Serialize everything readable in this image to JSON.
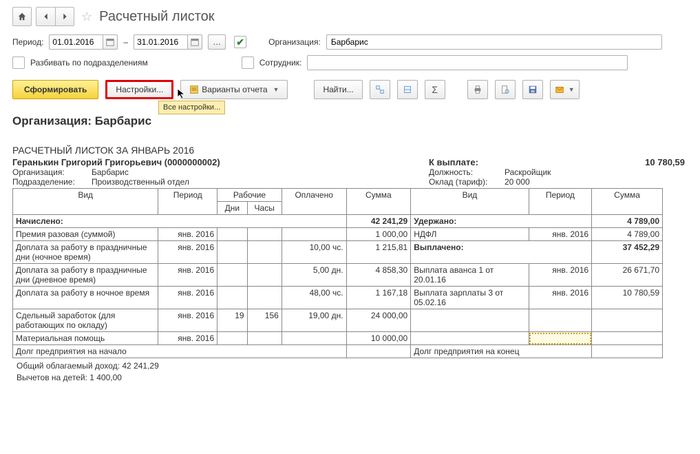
{
  "title": "Расчетный листок",
  "period_label": "Период:",
  "date_from": "01.01.2016",
  "date_sep": "–",
  "date_to": "31.01.2016",
  "org_label": "Организация:",
  "org_value": "Барбарис",
  "split_label": "Разбивать по подразделениям",
  "emp_label": "Сотрудник:",
  "btn_form": "Сформировать",
  "btn_settings": "Настройки...",
  "btn_variants": "Варианты отчета",
  "btn_find": "Найти...",
  "tooltip": "Все настройки...",
  "report": {
    "heading": "Организация: Барбарис",
    "subtitle": "РАСЧЕТНЫЙ ЛИСТОК ЗА ЯНВАРЬ 2016",
    "employee": "Геранькин Григорий Григорьевич (0000000002)",
    "org_lab": "Организация:",
    "org_val": "Барбарис",
    "dept_lab": "Подразделение:",
    "dept_val": "Производственный отдел",
    "pay_lab": "К выплате:",
    "pay_val": "10 780,59",
    "pos_lab": "Должность:",
    "pos_val": "Раскройщик",
    "sal_lab": "Оклад (тариф):",
    "sal_val": "20 000",
    "col_vid": "Вид",
    "col_period": "Период",
    "col_work": "Рабочие",
    "col_paid": "Оплачено",
    "col_sum": "Сумма",
    "col_days": "Дни",
    "col_hours": "Часы",
    "accrued_lab": "Начислено:",
    "accrued_val": "42 241,29",
    "withheld_lab": "Удержано:",
    "withheld_val": "4 789,00",
    "left_rows": [
      {
        "name": "Премия разовая (суммой)",
        "period": "янв. 2016",
        "days": "",
        "hours": "",
        "paid": "",
        "sum": "1 000,00"
      },
      {
        "name": "Доплата за работу в праздничные дни (ночное время)",
        "period": "янв. 2016",
        "days": "",
        "hours": "",
        "paid": "10,00 чс.",
        "sum": "1 215,81"
      },
      {
        "name": "Доплата за работу в праздничные дни (дневное время)",
        "period": "янв. 2016",
        "days": "",
        "hours": "",
        "paid": "5,00 дн.",
        "sum": "4 858,30"
      },
      {
        "name": "Доплата за работу в ночное время",
        "period": "янв. 2016",
        "days": "",
        "hours": "",
        "paid": "48,00 чс.",
        "sum": "1 167,18"
      },
      {
        "name": "Сдельный заработок (для работающих по окладу)",
        "period": "янв. 2016",
        "days": "19",
        "hours": "156",
        "paid": "19,00 дн.",
        "sum": "24 000,00"
      },
      {
        "name": "Материальная помощь",
        "period": "янв. 2016",
        "days": "",
        "hours": "",
        "paid": "",
        "sum": "10 000,00"
      }
    ],
    "right_withheld": [
      {
        "name": "НДФЛ",
        "period": "янв. 2016",
        "sum": "4 789,00"
      }
    ],
    "paid_lab": "Выплачено:",
    "paid_val": "37 452,29",
    "right_paid": [
      {
        "name": "Выплата аванса 1 от 20.01.16",
        "period": "янв. 2016",
        "sum": "26 671,70"
      },
      {
        "name": "Выплата зарплаты 3 от 05.02.16",
        "period": "янв. 2016",
        "sum": "10 780,59"
      }
    ],
    "debt_start": "Долг предприятия на начало",
    "debt_end": "Долг предприятия на конец",
    "taxable": "Общий облагаемый доход: 42 241,29",
    "deductions": "Вычетов на детей: 1 400,00"
  }
}
